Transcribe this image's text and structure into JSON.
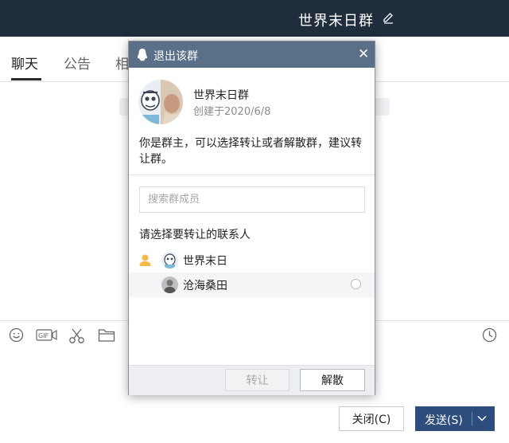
{
  "window": {
    "title": "世界末日群"
  },
  "tabs": [
    {
      "label": "聊天",
      "active": true
    },
    {
      "label": "公告",
      "active": false
    },
    {
      "label": "相",
      "active": false
    }
  ],
  "toolbar_icons": [
    "emoji-icon",
    "gif-icon",
    "scissors-icon",
    "folder-icon",
    "clock-icon"
  ],
  "bottom": {
    "close_label": "关闭(C)",
    "send_label": "发送(S)"
  },
  "dialog": {
    "title": "退出该群",
    "group": {
      "name": "世界末日群",
      "created": "创建于2020/6/8"
    },
    "notice": "你是群主，可以选择转让或者解散群，建议转让群。",
    "search_placeholder": "搜索群成员",
    "pick_label": "请选择要转让的联系人",
    "members": [
      {
        "name": "世界末日",
        "is_owner": true
      },
      {
        "name": "沧海桑田",
        "is_owner": false
      }
    ],
    "buttons": {
      "transfer": "转让",
      "dissolve": "解散"
    }
  },
  "colors": {
    "topbar": "#1f2d3d",
    "dialog_header": "#5a6f88",
    "send_button": "#2c4d7e"
  }
}
